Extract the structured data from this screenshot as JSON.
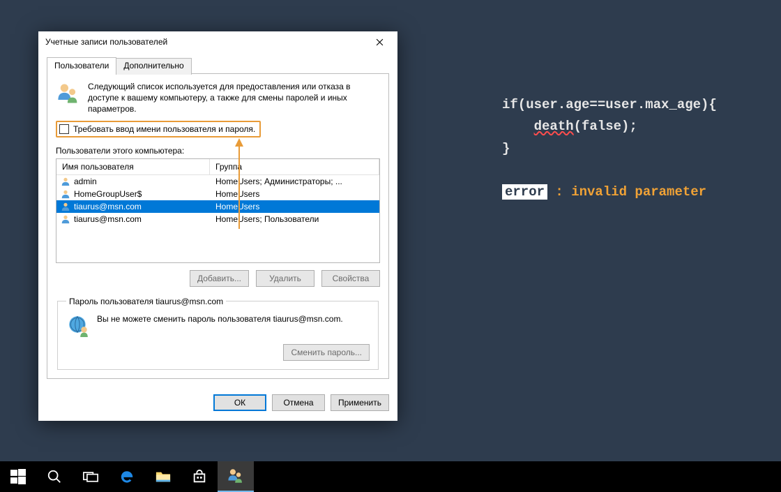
{
  "code_bg": {
    "l1_a": "if(user.age==user.max_age){",
    "l2_indent": "    ",
    "l2_a": "death",
    "l2_b": "(false);",
    "l3": "}",
    "err_label": "error",
    "err_rest": " : invalid parameter"
  },
  "dialog": {
    "title": "Учетные записи пользователей",
    "tabs": {
      "a": "Пользователи",
      "b": "Дополнительно"
    },
    "intro": "Следующий список используется для предоставления или отказа в доступе к вашему компьютеру, а также для смены паролей и иных параметров.",
    "require_label": "Требовать ввод имени пользователя и пароля.",
    "list_caption": "Пользователи этого компьютера:",
    "cols": {
      "a": "Имя пользователя",
      "b": "Группа"
    },
    "rows": [
      {
        "name": "admin",
        "group": "HomeUsers; Администраторы; ...",
        "selected": false
      },
      {
        "name": "HomeGroupUser$",
        "group": "HomeUsers",
        "selected": false
      },
      {
        "name": "tiaurus@msn.com",
        "group": "HomeUsers",
        "selected": true
      },
      {
        "name": "tiaurus@msn.com",
        "group": "HomeUsers; Пользователи",
        "selected": false
      }
    ],
    "btns": {
      "add": "Добавить...",
      "del": "Удалить",
      "prop": "Свойства"
    },
    "pw_group": {
      "legend": "Пароль пользователя tiaurus@msn.com",
      "text": "Вы не можете сменить пароль пользователя tiaurus@msn.com.",
      "btn": "Сменить пароль..."
    },
    "dlg_btns": {
      "ok": "ОК",
      "cancel": "Отмена",
      "apply": "Применить"
    }
  }
}
